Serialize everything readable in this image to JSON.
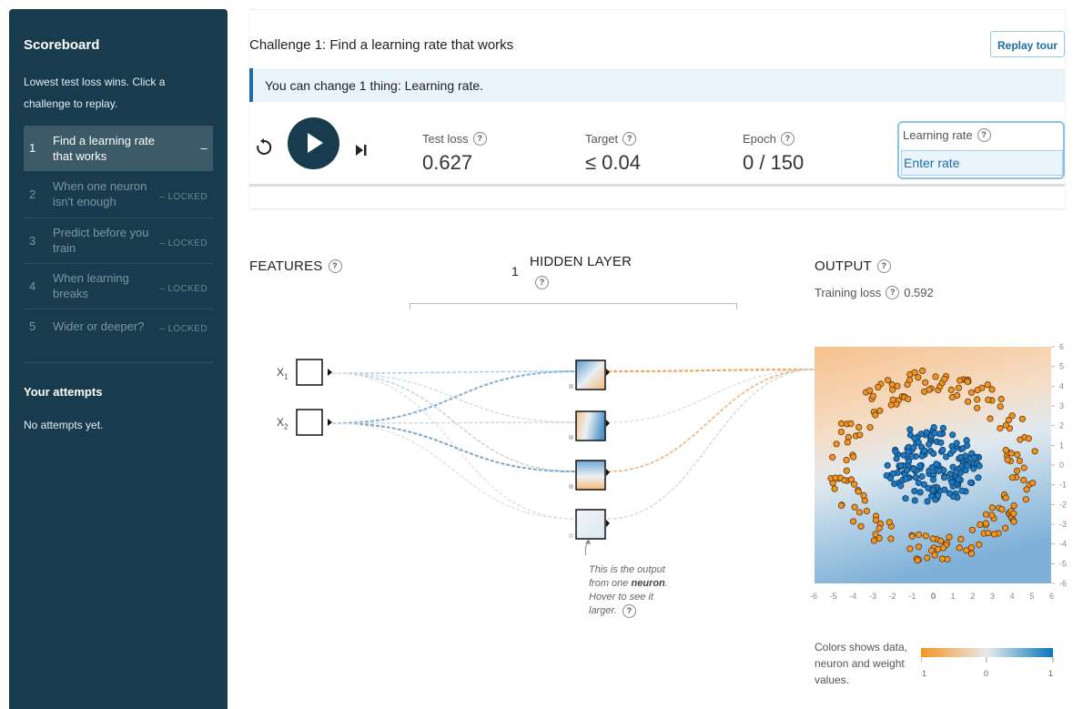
{
  "sidebar": {
    "title": "Scoreboard",
    "description": "Lowest test loss wins. Click a challenge to replay.",
    "challenges": [
      {
        "num": "1",
        "label": "Find a learning rate that works",
        "status": "–"
      },
      {
        "num": "2",
        "label": "When one neuron isn't enough",
        "status": "– LOCKED"
      },
      {
        "num": "3",
        "label": "Predict before you train",
        "status": "– LOCKED"
      },
      {
        "num": "4",
        "label": "When learning breaks",
        "status": "– LOCKED"
      },
      {
        "num": "5",
        "label": "Wider or deeper?",
        "status": "– LOCKED"
      }
    ],
    "attempts_title": "Your attempts",
    "attempts_text": "No attempts yet."
  },
  "challenge": {
    "title": "Challenge 1: Find a learning rate that works",
    "replay_label": "Replay tour",
    "notice": "You can change 1 thing: Learning rate."
  },
  "stats": {
    "test_loss_label": "Test loss",
    "test_loss_value": "0.627",
    "target_label": "Target",
    "target_value": "≤ 0.04",
    "epoch_label": "Epoch",
    "epoch_value": "0 / 150",
    "learning_rate_label": "Learning rate",
    "learning_rate_placeholder": "Enter rate"
  },
  "network": {
    "features_title": "FEATURES",
    "layers_count": "1",
    "hidden_title": "HIDDEN LAYER",
    "output_title": "OUTPUT",
    "training_loss_label": "Training loss",
    "training_loss_value": "0.592",
    "feature_1": "X",
    "feature_1_sub": "1",
    "feature_2": "X",
    "feature_2_sub": "2",
    "neuron_note_1": "This is the output from one",
    "neuron_note_bold": "neuron",
    "neuron_note_2": ". Hover to see it larger."
  },
  "plot": {
    "x_ticks": [
      "-6",
      "-5",
      "-4",
      "-3",
      "-2",
      "-1",
      "0",
      "1",
      "2",
      "3",
      "4",
      "5",
      "6"
    ],
    "y_ticks": [
      "6",
      "5",
      "4",
      "3",
      "2",
      "1",
      "0",
      "-1",
      "-2",
      "-3",
      "-4",
      "-5",
      "-6"
    ]
  },
  "legend": {
    "text": "Colors shows data, neuron and weight values.",
    "min_label": "-1",
    "mid_label": "0",
    "max_label": "1"
  },
  "colors": {
    "sidebar_bg": "#183c4e",
    "accent_blue": "#1f6fa5",
    "orange": "#f59322",
    "blue": "#0877bd"
  }
}
